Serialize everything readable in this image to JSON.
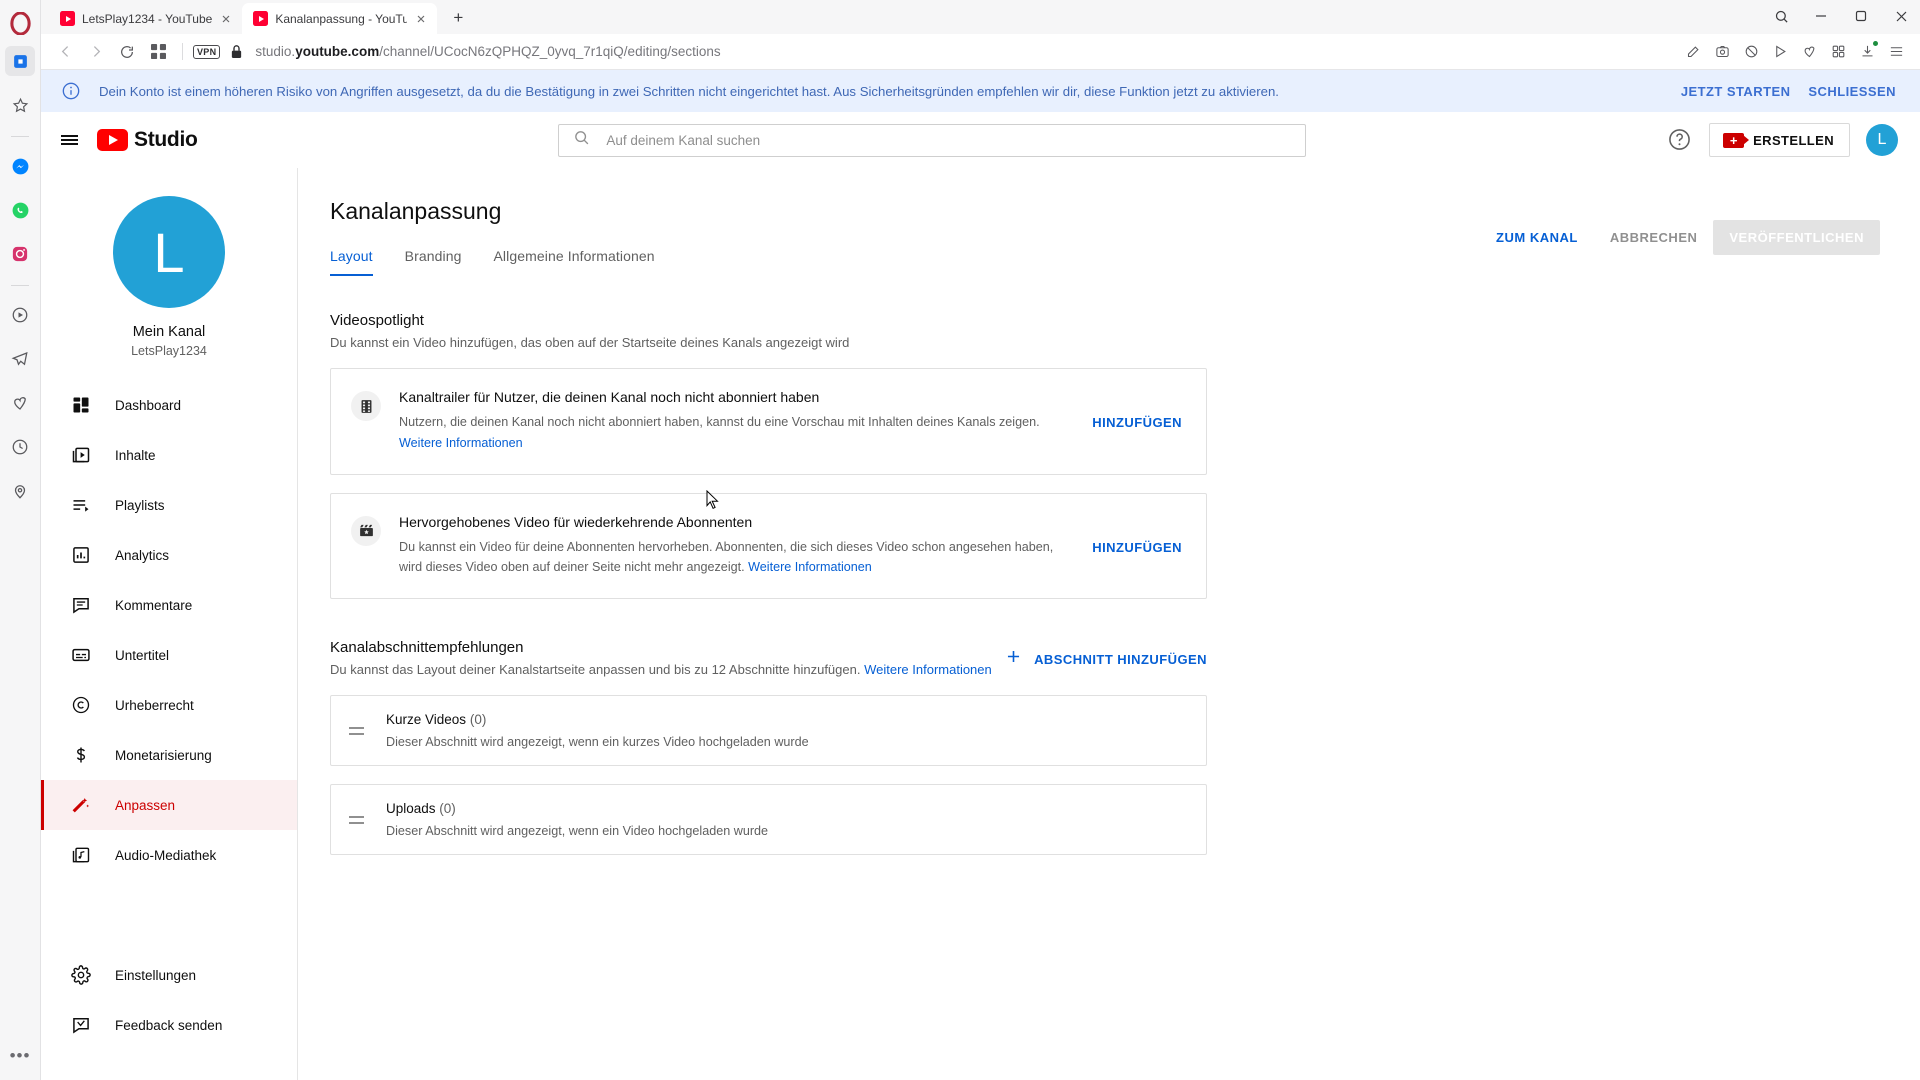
{
  "browser": {
    "name": "Opera",
    "tabs": [
      {
        "title": "LetsPlay1234 - YouTube",
        "active": false,
        "favicon": "youtube-icon"
      },
      {
        "title": "Kanalanpassung - YouTube",
        "active": true,
        "favicon": "youtube-icon"
      }
    ],
    "new_tab_label": "+",
    "url_prefix": "studio.",
    "url_domain": "youtube.com",
    "url_path": "/channel/UCocN6zQPHQZ_0yvq_7r1qiQ/editing/sections",
    "vpn_badge": "VPN",
    "window_controls": [
      "minimize",
      "maximize",
      "close"
    ],
    "nav_icons": [
      "back-icon",
      "forward-icon",
      "reload-icon",
      "tab-grid-icon"
    ],
    "address_icons": [
      "edit-icon",
      "screenshot-icon",
      "block-ads-icon",
      "player-icon",
      "heart-icon",
      "extensions-icon",
      "downloads-icon",
      "opera-menu-icon"
    ],
    "rail_icons": [
      "opera-logo-icon",
      "workspace-icon",
      "star-icon",
      "messenger-icon",
      "whatsapp-icon",
      "instagram-icon",
      "player-icon",
      "telegram-icon",
      "heart-icon",
      "history-icon",
      "pin-icon",
      "more-icon"
    ]
  },
  "alert": {
    "icon": "info-icon",
    "message": "Dein Konto ist einem höheren Risiko von Angriffen ausgesetzt, da du die Bestätigung in zwei Schritten nicht eingerichtet hast. Aus Sicherheitsgründen empfehlen wir dir, diese Funktion jetzt zu aktivieren.",
    "primary_action": "JETZT STARTEN",
    "dismiss_action": "SCHLIESSEN",
    "bg_color": "#e8f0fe",
    "text_color": "#3f68b5"
  },
  "header": {
    "menu_icon": "hamburger-menu-icon",
    "brand": "Studio",
    "brand_icon": "youtube-play-icon",
    "search_placeholder": "Auf deinem Kanal suchen",
    "search_value": "",
    "search_icon": "search-icon",
    "help_icon": "help-circle-icon",
    "create_label": "ERSTELLEN",
    "create_icon": "video-camera-plus-icon",
    "avatar_letter": "L",
    "avatar_color": "#22a1d6"
  },
  "sidebar": {
    "avatar_letter": "L",
    "channel_name": "Mein Kanal",
    "channel_handle": "LetsPlay1234",
    "items": [
      {
        "label": "Dashboard",
        "icon": "dashboard-icon",
        "active": false
      },
      {
        "label": "Inhalte",
        "icon": "content-video-icon",
        "active": false
      },
      {
        "label": "Playlists",
        "icon": "playlist-icon",
        "active": false
      },
      {
        "label": "Analytics",
        "icon": "analytics-bar-icon",
        "active": false
      },
      {
        "label": "Kommentare",
        "icon": "comment-icon",
        "active": false
      },
      {
        "label": "Untertitel",
        "icon": "subtitles-icon",
        "active": false
      },
      {
        "label": "Urheberrecht",
        "icon": "copyright-icon",
        "active": false
      },
      {
        "label": "Monetarisierung",
        "icon": "dollar-icon",
        "active": false
      },
      {
        "label": "Anpassen",
        "icon": "magic-wand-icon",
        "active": true
      },
      {
        "label": "Audio-Mediathek",
        "icon": "music-library-icon",
        "active": false
      }
    ],
    "footer_items": [
      {
        "label": "Einstellungen",
        "icon": "gear-icon"
      },
      {
        "label": "Feedback senden",
        "icon": "feedback-icon"
      }
    ],
    "active_color": "#cc0000"
  },
  "main": {
    "page_title": "Kanalanpassung",
    "tabs": [
      {
        "label": "Layout",
        "selected": true
      },
      {
        "label": "Branding",
        "selected": false
      },
      {
        "label": "Allgemeine Informationen",
        "selected": false
      }
    ],
    "actions": {
      "view_channel": "ZUM KANAL",
      "cancel": "ABBRECHEN",
      "publish": "VERÖFFENTLICHEN",
      "publish_disabled": true
    },
    "spotlight": {
      "title": "Videospotlight",
      "subtitle": "Du kannst ein Video hinzufügen, das oben auf der Startseite deines Kanals angezeigt wird",
      "cards": [
        {
          "icon": "film-strip-icon",
          "title": "Kanaltrailer für Nutzer, die deinen Kanal noch nicht abonniert haben",
          "desc": "Nutzern, die deinen Kanal noch nicht abonniert haben, kannst du eine Vorschau mit Inhalten deines Kanals zeigen.",
          "link": "Weitere Informationen",
          "link_inline": false,
          "action": "HINZUFÜGEN"
        },
        {
          "icon": "clapperboard-star-icon",
          "title": "Hervorgehobenes Video für wiederkehrende Abonnenten",
          "desc": "Du kannst ein Video für deine Abonnenten hervorheben. Abonnenten, die sich dieses Video schon angesehen haben, wird dieses Video oben auf deiner Seite nicht mehr angezeigt.",
          "link": "Weitere Informationen",
          "link_inline": true,
          "action": "HINZUFÜGEN"
        }
      ]
    },
    "sections": {
      "title": "Kanalabschnittempfehlungen",
      "subtitle": "Du kannst das Layout deiner Kanalstartseite anpassen und bis zu 12 Abschnitte hinzufügen.",
      "subtitle_link": "Weitere Informationen",
      "add_label": "ABSCHNITT HINZUFÜGEN",
      "add_icon": "plus-icon",
      "rows": [
        {
          "title": "Kurze Videos",
          "count": "(0)",
          "desc": "Dieser Abschnitt wird angezeigt, wenn ein kurzes Video hochgeladen wurde",
          "handle_icon": "drag-handle-icon"
        },
        {
          "title": "Uploads",
          "count": "(0)",
          "desc": "Dieser Abschnitt wird angezeigt, wenn ein Video hochgeladen wurde",
          "handle_icon": "drag-handle-icon"
        }
      ]
    },
    "link_color": "#065fd4"
  }
}
